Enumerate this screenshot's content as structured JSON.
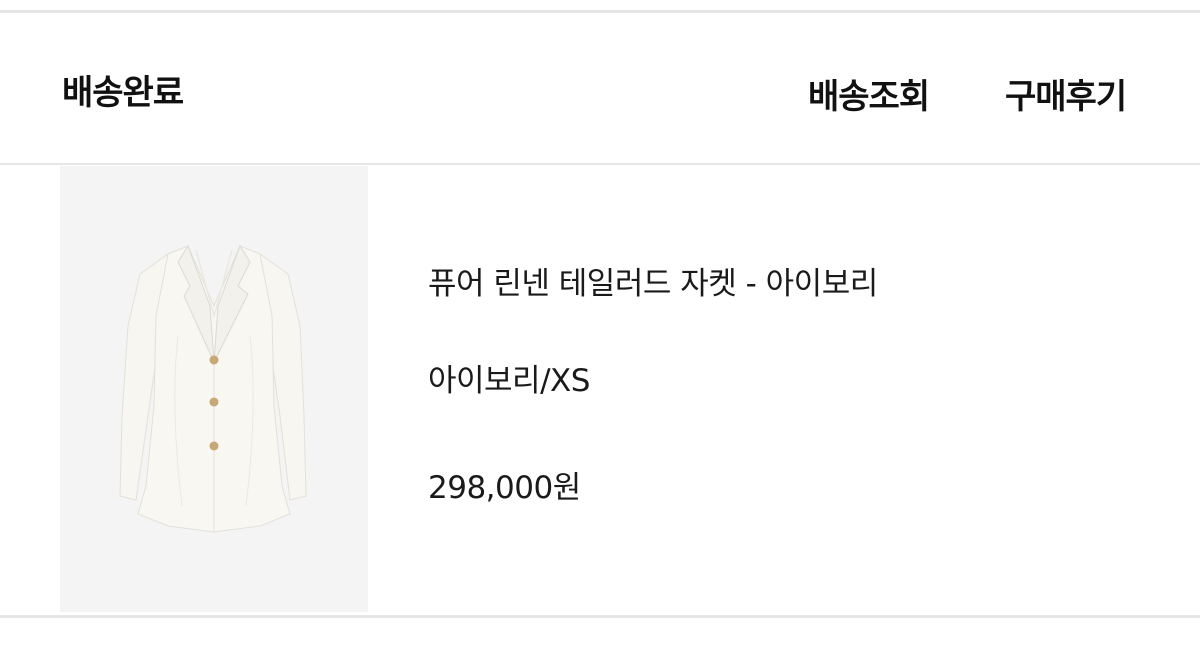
{
  "order": {
    "status": "배송완료",
    "actions": {
      "track": "배송조회",
      "review": "구매후기"
    }
  },
  "product": {
    "name": "퓨어 린넨 테일러드 자켓 - 아이보리",
    "option": "아이보리/XS",
    "price": "298,000원",
    "image": "ivory-tailored-jacket-image"
  },
  "colors": {
    "divider": "#e6e6e6",
    "thumbnail_bg": "#f4f4f4",
    "jacket": "#f7f6f1",
    "buttons": "#c8a878"
  }
}
